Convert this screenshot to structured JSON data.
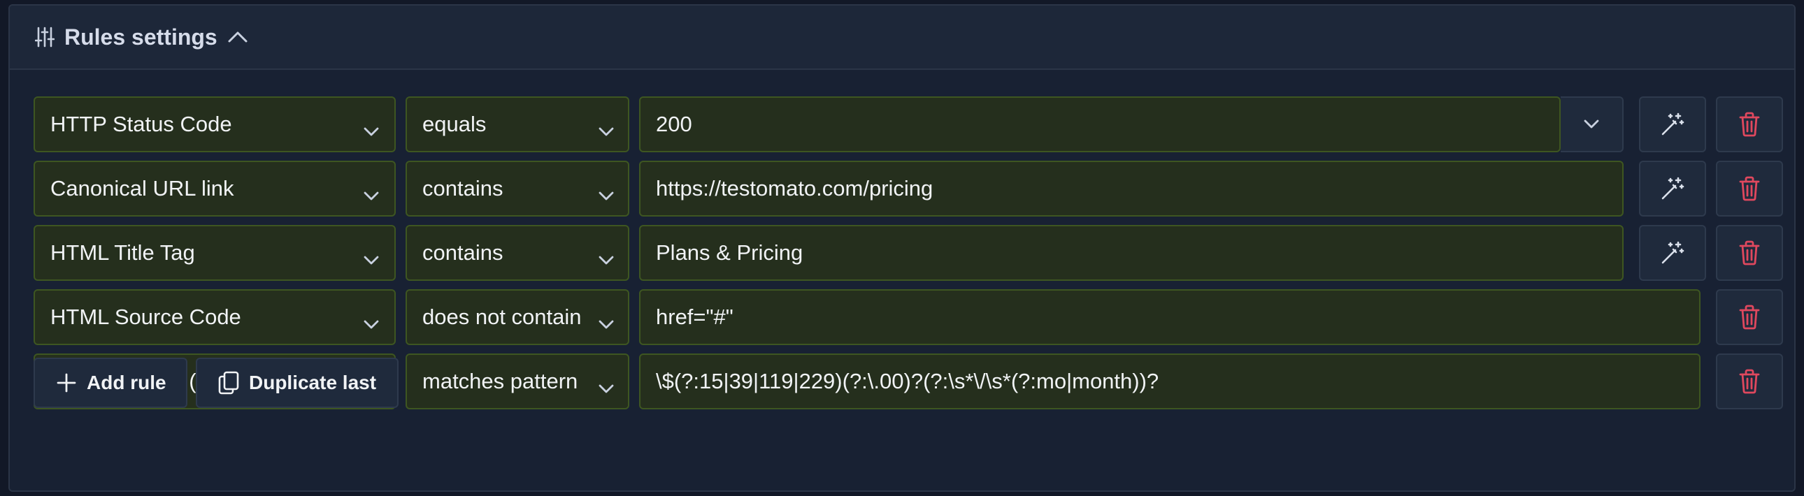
{
  "header": {
    "title": "Rules settings",
    "icon": "sliders-icon",
    "toggle_icon": "chevron-up-icon"
  },
  "rules": [
    {
      "type": "HTTP Status Code",
      "operator": "equals",
      "value": "200",
      "has_value_dropdown": true,
      "has_magic": true
    },
    {
      "type": "Canonical URL link",
      "operator": "contains",
      "value": "https://testomato.com/pricing",
      "has_value_dropdown": false,
      "has_magic": true
    },
    {
      "type": "HTML Title Tag",
      "operator": "contains",
      "value": "Plans & Pricing",
      "has_value_dropdown": false,
      "has_magic": true
    },
    {
      "type": "HTML Source Code",
      "operator": "does not contain",
      "value": "href=\"#\"",
      "has_value_dropdown": false,
      "has_magic": false
    },
    {
      "type": "Page Content (Text)",
      "operator": "matches pattern",
      "value": "\\$(?:15|39|119|229)(?:\\.00)?(?:\\s*\\/\\s*(?:mo|month))?",
      "has_value_dropdown": false,
      "has_magic": false
    }
  ],
  "actions": {
    "add_rule_label": "Add rule",
    "duplicate_last_label": "Duplicate last"
  },
  "icons": {
    "magic": "magic-wand-icon",
    "delete": "trash-icon",
    "add": "plus-icon",
    "duplicate": "copy-icon",
    "select": "chevron-down-icon"
  },
  "colors": {
    "background": "#182133",
    "field_bg": "#252f1d",
    "field_border": "#3e5621",
    "danger": "#e0485e",
    "text": "#f1f3f5"
  }
}
